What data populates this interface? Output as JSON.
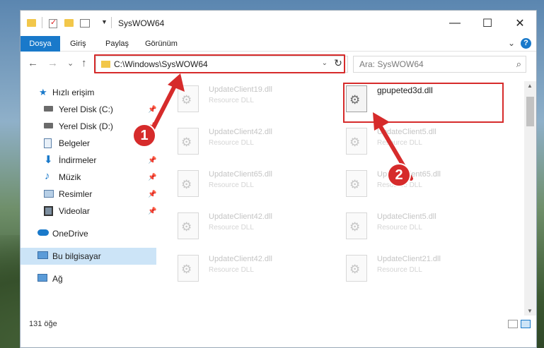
{
  "window": {
    "title": "SysWOW64",
    "controls": {
      "minimize": "—",
      "maximize": "☐",
      "close": "✕"
    }
  },
  "ribbon": {
    "tabs": [
      "Dosya",
      "Giriş",
      "Paylaş",
      "Görünüm"
    ],
    "active_tab": "Dosya",
    "expand_chevron": "⌄",
    "help": "?"
  },
  "address": {
    "path": "C:\\Windows\\SysWOW64",
    "back": "←",
    "forward": "→",
    "recent": "⌄",
    "up": "↑",
    "dropdown": "⌄",
    "refresh": "↻"
  },
  "search": {
    "placeholder": "Ara: SysWOW64",
    "icon": "search-icon"
  },
  "sidebar": {
    "items": [
      {
        "label": "Hızlı erişim",
        "icon": "star-icon"
      },
      {
        "label": "Yerel Disk (C:)",
        "icon": "drive-icon",
        "pinned": true
      },
      {
        "label": "Yerel Disk (D:)",
        "icon": "drive-icon",
        "pinned": true
      },
      {
        "label": "Belgeler",
        "icon": "documents-icon",
        "pinned": false
      },
      {
        "label": "İndirmeler",
        "icon": "downloads-icon",
        "pinned": true
      },
      {
        "label": "Müzik",
        "icon": "music-icon",
        "pinned": true
      },
      {
        "label": "Resimler",
        "icon": "pictures-icon",
        "pinned": true
      },
      {
        "label": "Videolar",
        "icon": "videos-icon",
        "pinned": true
      },
      {
        "label": "OneDrive",
        "icon": "cloud-icon"
      },
      {
        "label": "Bu bilgisayar",
        "icon": "computer-icon",
        "selected": true
      },
      {
        "label": "Ağ",
        "icon": "network-icon"
      }
    ]
  },
  "files": [
    {
      "name": "UpdateClient19.dll",
      "type": "Resource DLL"
    },
    {
      "name": "gpupeted3d.dll",
      "type": "",
      "highlighted": true
    },
    {
      "name": "UpdateClient42.dll",
      "type": "Resource DLL"
    },
    {
      "name": "UpdateClient5.dll",
      "type": "Resource DLL"
    },
    {
      "name": "UpdateClient65.dll",
      "type": "Resource DLL"
    },
    {
      "name": "UpdateClient65.dll",
      "type": "Resource DLL"
    },
    {
      "name": "UpdateClient42.dll",
      "type": "Resource DLL"
    },
    {
      "name": "UpdateClient5.dll",
      "type": "Resource DLL"
    },
    {
      "name": "UpdateClient42.dll",
      "type": "Resource DLL"
    },
    {
      "name": "UpdateClient21.dll",
      "type": "Resource DLL"
    }
  ],
  "status": {
    "count": "131 öğe"
  },
  "callouts": {
    "one": "1",
    "two": "2"
  },
  "colors": {
    "accent": "#1979ca",
    "highlight": "#d62b2b",
    "selection": "#cce4f7"
  }
}
